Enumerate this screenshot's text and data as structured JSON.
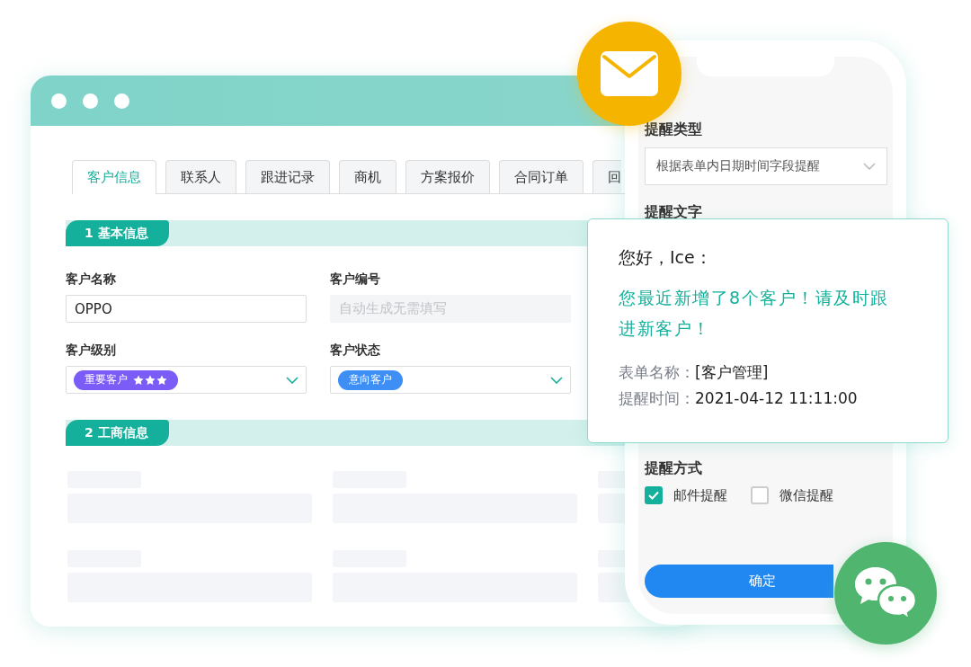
{
  "browser_window": {
    "tabs": [
      {
        "label": "客户信息",
        "selected": true
      },
      {
        "label": "联系人",
        "selected": false
      },
      {
        "label": "跟进记录",
        "selected": false
      },
      {
        "label": "商机",
        "selected": false
      },
      {
        "label": "方案报价",
        "selected": false
      },
      {
        "label": "合同订单",
        "selected": false
      },
      {
        "label": "回",
        "selected": false
      }
    ],
    "sections": [
      {
        "title": "1 基本信息",
        "kind": "form",
        "fields": [
          {
            "label": "客户名称",
            "kind": "input",
            "value": "OPPO",
            "disabled": false
          },
          {
            "label": "客户编号",
            "kind": "input",
            "placeholder": "自动生成无需填写",
            "disabled": true
          },
          {
            "label": "客户级别",
            "kind": "select",
            "tag": {
              "text": "重要客户",
              "stars": 3,
              "color": "#7b5cf6"
            }
          },
          {
            "label": "客户状态",
            "kind": "select",
            "tag": {
              "text": "意向客户",
              "color": "#3d8ff6"
            }
          }
        ]
      },
      {
        "title": "2 工商信息",
        "kind": "skeleton"
      }
    ]
  },
  "phone": {
    "reminder_type": {
      "label": "提醒类型",
      "value": "根据表单内日期时间字段提醒"
    },
    "reminder_text": {
      "label": "提醒文字"
    },
    "reminder_method": {
      "label": "提醒方式",
      "options": [
        {
          "label": "邮件提醒",
          "checked": true
        },
        {
          "label": "微信提醒",
          "checked": false
        }
      ]
    },
    "confirm_button": "确定"
  },
  "notification": {
    "greeting": "您好，Ice：",
    "message": "您最近新增了8个客户！请及时跟进新客户！",
    "details": [
      {
        "label": "表单名称：",
        "value": "[客户管理]"
      },
      {
        "label": "提醒时间：",
        "value": "2021-04-12 11:11:00"
      }
    ]
  }
}
